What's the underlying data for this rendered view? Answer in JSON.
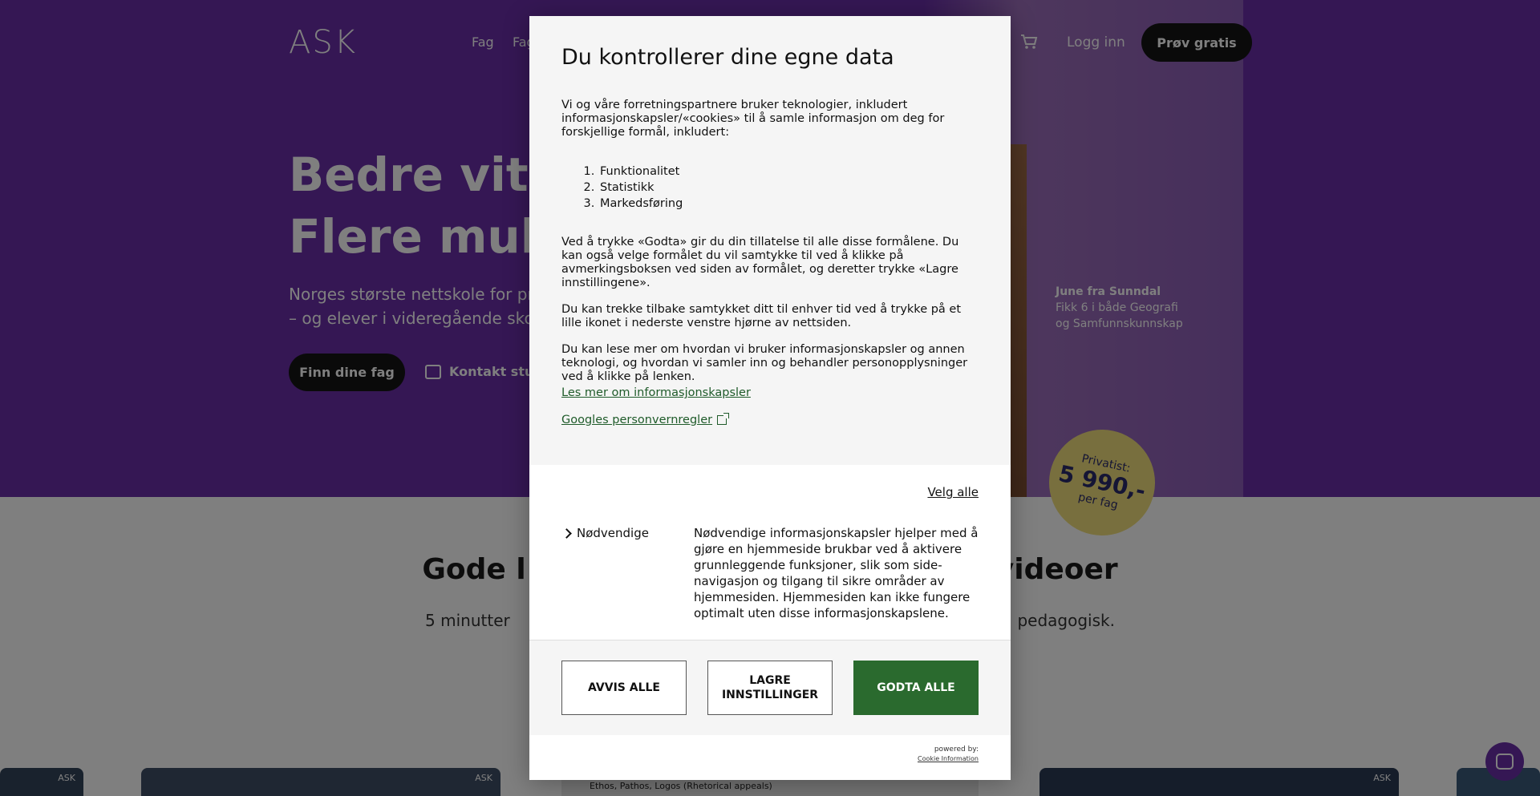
{
  "header": {
    "logo": "ASK",
    "nav": [
      "Fag",
      "Fag"
    ],
    "login": "Logg inn",
    "try_free": "Prøv gratis"
  },
  "hero": {
    "title_line1": "Bedre vitne",
    "title_line2": "Flere mulig",
    "sub_line1": "Norges største nettskole for priva",
    "sub_line2": "– og elever i videregående skole.",
    "find_button": "Finn dine fag",
    "contact_link": "Kontakt studi",
    "testimonial_name": "June fra Sunndal",
    "testimonial_line1": "Fikk 6 i både Geografi",
    "testimonial_line2": "og Samfunnskunnskap",
    "price_label": "Privatist:",
    "price_value": "5 990,-",
    "price_unit": "per fag"
  },
  "section": {
    "title_left": "Gode l",
    "title_right": "videoer",
    "sub_left": "5 minutter",
    "sub_right": "pedagogisk."
  },
  "cards": {
    "ask_label": "ASK",
    "card3_caption": "Ethos, Pathos, Logos (Rhetorical appeals)"
  },
  "cookie_dialog": {
    "title": "Du kontrollerer dine egne data",
    "intro": "Vi og våre forretningspartnere bruker teknologier, inkludert informasjonskapsler/«cookies» til å samle informasjon om deg for forskjellige formål, inkludert:",
    "purposes": [
      "Funktionalitet",
      "Statistikk",
      "Markedsføring"
    ],
    "consent_text": "Ved å trykke «Godta» gir du din tillatelse til alle disse formålene. Du kan også velge formålet du vil samtykke til ved å klikke på avmerkingsboksen ved siden av formålet, og deretter trykke «Lagre innstillingene».",
    "withdraw_text": "Du kan trekke tilbake samtykket ditt til enhver tid ved å trykke på et lille ikonet i nederste venstre hjørne av nettsiden.",
    "read_more_text": "Du kan lese mer om hvordan vi bruker informasjonskapsler og annen teknologi, og hvordan vi samler inn og behandler personopplysninger ved å klikke på lenken.",
    "read_more_link": "Les mer om informasjonskapsler",
    "google_link": "Googles personvernregler",
    "select_all": "Velg alle",
    "category_name": "Nødvendige",
    "category_desc": "Nødvendige informasjonskapsler hjelper med å gjøre en hjemmeside brukbar ved å aktivere grunnleggende funksjoner, slik som side-navigasjon og tilgang til sikre områder av hjemmesiden. Hjemmesiden kan ikke fungere optimalt uten disse informasjonskapslene.",
    "reject_all": "AVVIS ALLE",
    "save_settings": "LAGRE INNSTILLINGER",
    "accept_all": "GODTA ALLE",
    "powered_by": "powered by:",
    "powered_name": "Cookie Information"
  },
  "colors": {
    "hero_purple": "#6a2ea8",
    "accept_green": "#2a6a2e",
    "link_green": "#1f5b2a",
    "badge_yellow": "#f1df7c"
  }
}
